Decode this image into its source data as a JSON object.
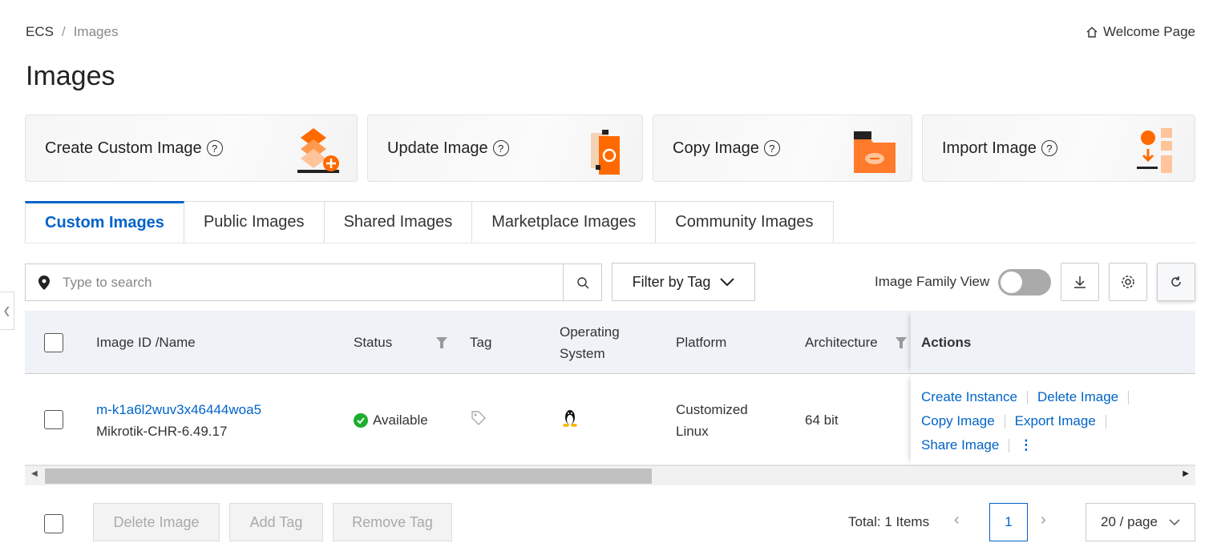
{
  "breadcrumb": {
    "root": "ECS",
    "sep": "/",
    "current": "Images"
  },
  "welcome": "Welcome Page",
  "title": "Images",
  "cards": [
    {
      "label": "Create Custom Image",
      "help": "?"
    },
    {
      "label": "Update Image",
      "help": "?"
    },
    {
      "label": "Copy Image",
      "help": "?"
    },
    {
      "label": "Import Image",
      "help": "?"
    }
  ],
  "tabs": [
    "Custom Images",
    "Public Images",
    "Shared Images",
    "Marketplace Images",
    "Community Images"
  ],
  "search": {
    "placeholder": "Type to search"
  },
  "filter_tag": "Filter by Tag",
  "family_view": {
    "label": "Image Family View",
    "on": false
  },
  "columns": {
    "id": "Image ID /Name",
    "status": "Status",
    "tag": "Tag",
    "os1": "Operating",
    "os2": "System",
    "platform": "Platform",
    "arch": "Architecture",
    "actions": "Actions"
  },
  "rows": [
    {
      "id": "m-k1a6l2wuv3x46444woa5",
      "name": "Mikrotik-CHR-6.49.17",
      "status": "Available",
      "status_color": "#1fad2e",
      "os_icon": "linux-tux-icon",
      "platform1": "Customized",
      "platform2": "Linux",
      "arch": "64 bit",
      "actions": [
        "Create Instance",
        "Delete Image",
        "Copy Image",
        "Export Image",
        "Share Image"
      ]
    }
  ],
  "bulk": {
    "delete": "Delete Image",
    "add_tag": "Add Tag",
    "remove_tag": "Remove Tag"
  },
  "pagination": {
    "total": "Total: 1 Items",
    "page": "1",
    "per_page": "20 / page"
  },
  "colors": {
    "accent": "#0064c8",
    "orange": "#ff6a00"
  }
}
